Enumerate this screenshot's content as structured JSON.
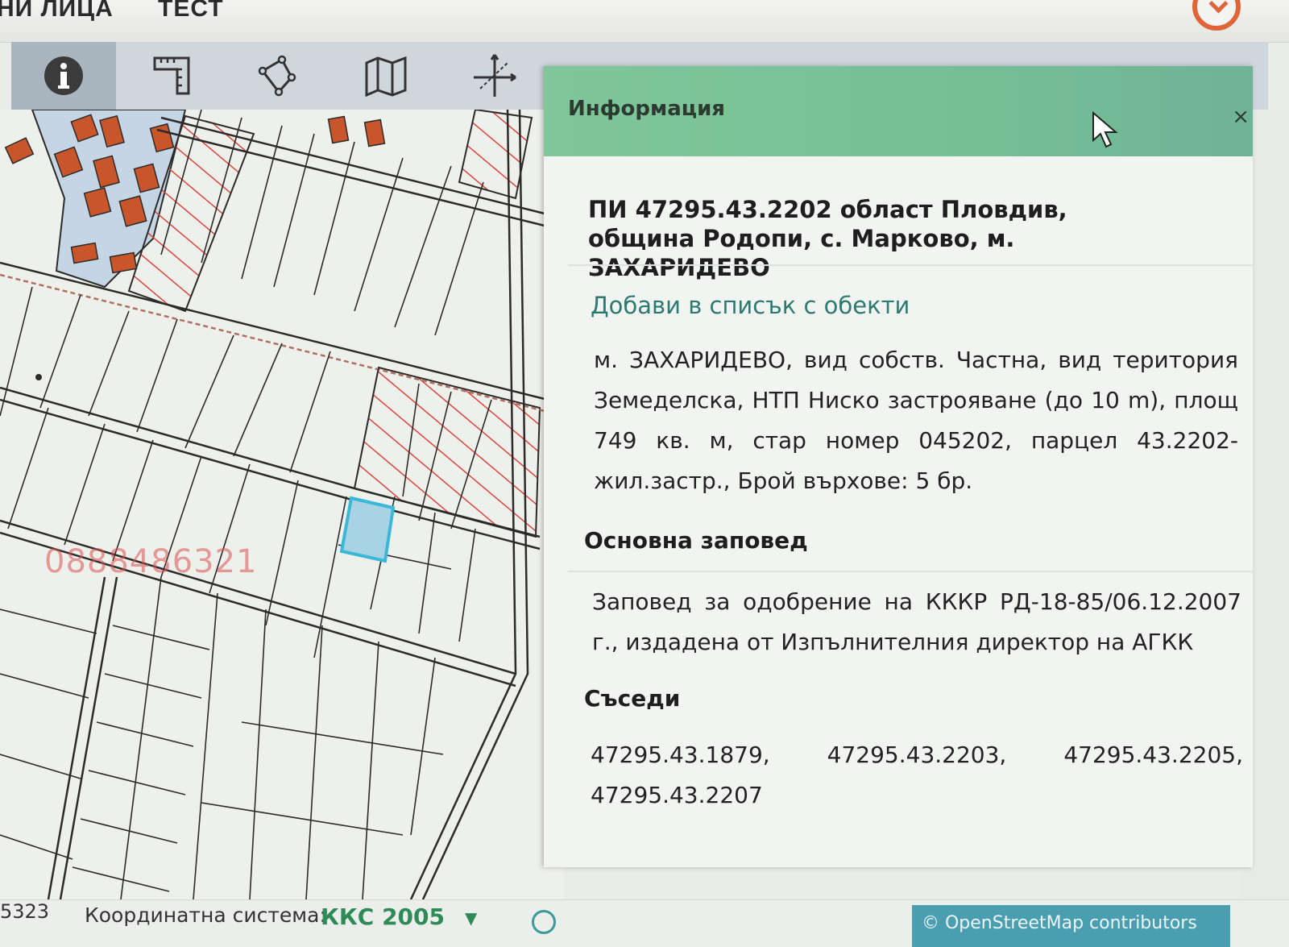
{
  "header": {
    "nav_left": "НИ ЛИЦА",
    "nav_right": "ТЕСТ"
  },
  "toolbar": {
    "tools": [
      {
        "icon": "info-icon"
      },
      {
        "icon": "ruler-icon"
      },
      {
        "icon": "polygon-icon"
      },
      {
        "icon": "map-icon"
      },
      {
        "icon": "coordinates-icon"
      },
      {
        "icon": "rectangle-icon"
      },
      {
        "icon": "print-icon"
      }
    ]
  },
  "map": {
    "watermark": "0888486321",
    "colors": {
      "parcel_line": "#2b2b2b",
      "hatch": "#d9453c",
      "building": "#c8562a",
      "selected": "#3ab8d8"
    }
  },
  "panel": {
    "title": "Информация",
    "close_label": "×",
    "parcel_title": "ПИ 47295.43.2202 област Пловдив, община Родопи, с. Марково, м. ЗАХАРИДЕВО",
    "add_link": "Добави в списък с обекти",
    "description": "м. ЗАХАРИДЕВО, вид собств. Частна, вид територия Земеделска, НТП Ниско застрояване (до 10 m), площ 749 кв. м, стар номер 045202, парцел 43.2202-жил.застр., Брой върхове: 5 бр.",
    "order_heading": "Основна заповед",
    "order_text": "Заповед за одобрение на КККР РД-18-85/06.12.2007 г., издадена от Изпълнителния директор на АГКК",
    "neighbors_heading": "Съседи",
    "neighbors": [
      "47295.43.1879,",
      "47295.43.2203,",
      "47295.43.2205,",
      "47295.43.2207"
    ]
  },
  "status": {
    "coord_fragment": "5323",
    "coord_label": "Координатна система:",
    "coord_value": "ККС 2005",
    "dropdown_icon": "▼",
    "attribution": "© OpenStreetMap contributors"
  },
  "accent_colors": {
    "panel_header": "#7fc79a",
    "link": "#2d7a73",
    "brand": "#2e8b57"
  }
}
